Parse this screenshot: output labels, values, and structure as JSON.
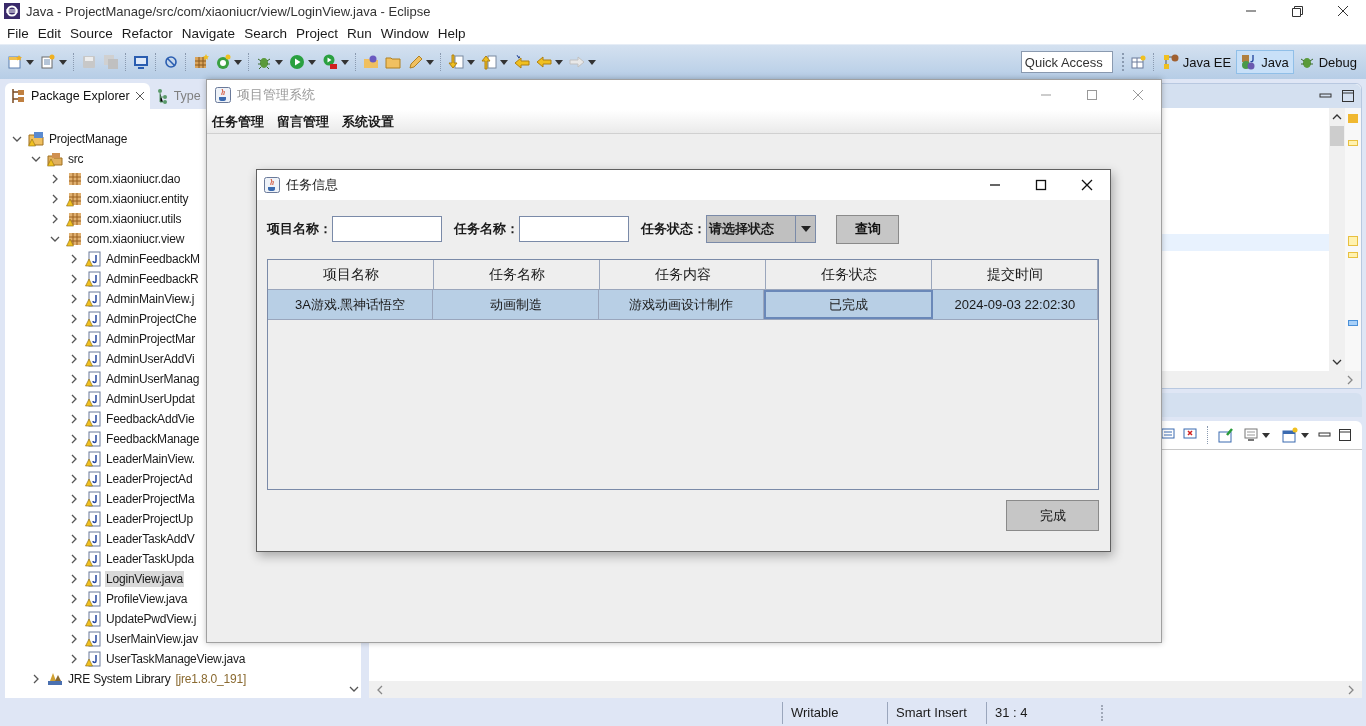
{
  "window": {
    "title": "Java - ProjectManage/src/com/xiaoniucr/view/LoginView.java - Eclipse"
  },
  "menu": [
    "File",
    "Edit",
    "Source",
    "Refactor",
    "Navigate",
    "Search",
    "Project",
    "Run",
    "Window",
    "Help"
  ],
  "quick_access": {
    "placeholder": "Quick Access"
  },
  "perspectives": [
    {
      "label": "Java EE",
      "kind": "javaee",
      "selected": false
    },
    {
      "label": "Java",
      "kind": "java",
      "selected": true
    },
    {
      "label": "Debug",
      "kind": "debug",
      "selected": false
    }
  ],
  "explorer": {
    "tabs": [
      {
        "label": "Package Explorer",
        "selected": true
      },
      {
        "label": "Type",
        "selected": false
      }
    ],
    "tree": [
      {
        "label": "ProjectManage",
        "kind": "project",
        "expanded": true,
        "children": [
          {
            "label": "src",
            "kind": "source",
            "expanded": true,
            "children": [
              {
                "label": "com.xiaoniucr.dao",
                "kind": "package",
                "warning": false,
                "expanded": false
              },
              {
                "label": "com.xiaoniucr.entity",
                "kind": "package",
                "warning": true,
                "expanded": false
              },
              {
                "label": "com.xiaoniucr.utils",
                "kind": "package",
                "warning": true,
                "expanded": false
              },
              {
                "label": "com.xiaoniucr.view",
                "kind": "package",
                "warning": true,
                "expanded": true,
                "children": [
                  {
                    "label": "AdminFeedbackM",
                    "kind": "file",
                    "selected": false
                  },
                  {
                    "label": "AdminFeedbackR",
                    "kind": "file",
                    "selected": false
                  },
                  {
                    "label": "AdminMainView.j",
                    "kind": "file",
                    "selected": false
                  },
                  {
                    "label": "AdminProjectChe",
                    "kind": "file",
                    "selected": false
                  },
                  {
                    "label": "AdminProjectMar",
                    "kind": "file",
                    "selected": false
                  },
                  {
                    "label": "AdminUserAddVi",
                    "kind": "file",
                    "selected": false
                  },
                  {
                    "label": "AdminUserManag",
                    "kind": "file",
                    "selected": false
                  },
                  {
                    "label": "AdminUserUpdat",
                    "kind": "file",
                    "selected": false
                  },
                  {
                    "label": "FeedbackAddVie",
                    "kind": "file",
                    "selected": false
                  },
                  {
                    "label": "FeedbackManage",
                    "kind": "file",
                    "selected": false
                  },
                  {
                    "label": "LeaderMainView.",
                    "kind": "file",
                    "selected": false
                  },
                  {
                    "label": "LeaderProjectAd",
                    "kind": "file",
                    "selected": false
                  },
                  {
                    "label": "LeaderProjectMa",
                    "kind": "file",
                    "selected": false
                  },
                  {
                    "label": "LeaderProjectUp",
                    "kind": "file",
                    "selected": false
                  },
                  {
                    "label": "LeaderTaskAddV",
                    "kind": "file",
                    "selected": false
                  },
                  {
                    "label": "LeaderTaskUpda",
                    "kind": "file",
                    "selected": false
                  },
                  {
                    "label": "LoginView.java",
                    "kind": "file",
                    "selected": true
                  },
                  {
                    "label": "ProfileView.java",
                    "kind": "file",
                    "selected": false
                  },
                  {
                    "label": "UpdatePwdView.j",
                    "kind": "file",
                    "selected": false
                  },
                  {
                    "label": "UserMainView.jav",
                    "kind": "file",
                    "selected": false
                  },
                  {
                    "label": "UserTaskManageView.java",
                    "kind": "file",
                    "selected": false
                  }
                ]
              }
            ]
          },
          {
            "label": "JRE System Library",
            "kind": "library",
            "detail": "[jre1.8.0_191]",
            "expanded": false
          }
        ]
      }
    ]
  },
  "status_bar": [
    "Writable",
    "Smart Insert",
    "31 : 4"
  ],
  "app_window": {
    "title": "项目管理系统",
    "menu": [
      "任务管理",
      "留言管理",
      "系统设置"
    ]
  },
  "dialog": {
    "title": "任务信息",
    "filters": [
      {
        "kind": "text",
        "label": "项目名称："
      },
      {
        "kind": "text",
        "label": "任务名称："
      },
      {
        "kind": "select",
        "label": "任务状态：",
        "value": "请选择状态"
      }
    ],
    "query_button": "查询",
    "table": {
      "columns": [
        "项目名称",
        "任务名称",
        "任务内容",
        "任务状态",
        "提交时间"
      ],
      "rows": [
        {
          "selected": true,
          "cells": [
            {
              "text": "3A游戏.黑神话悟空",
              "focused": false
            },
            {
              "text": "动画制造",
              "focused": false
            },
            {
              "text": "游戏动画设计制作",
              "focused": false
            },
            {
              "text": "已完成",
              "focused": true
            },
            {
              "text": "2024-09-03 22:02:30",
              "focused": false
            }
          ]
        }
      ]
    },
    "done_button": "完成"
  }
}
